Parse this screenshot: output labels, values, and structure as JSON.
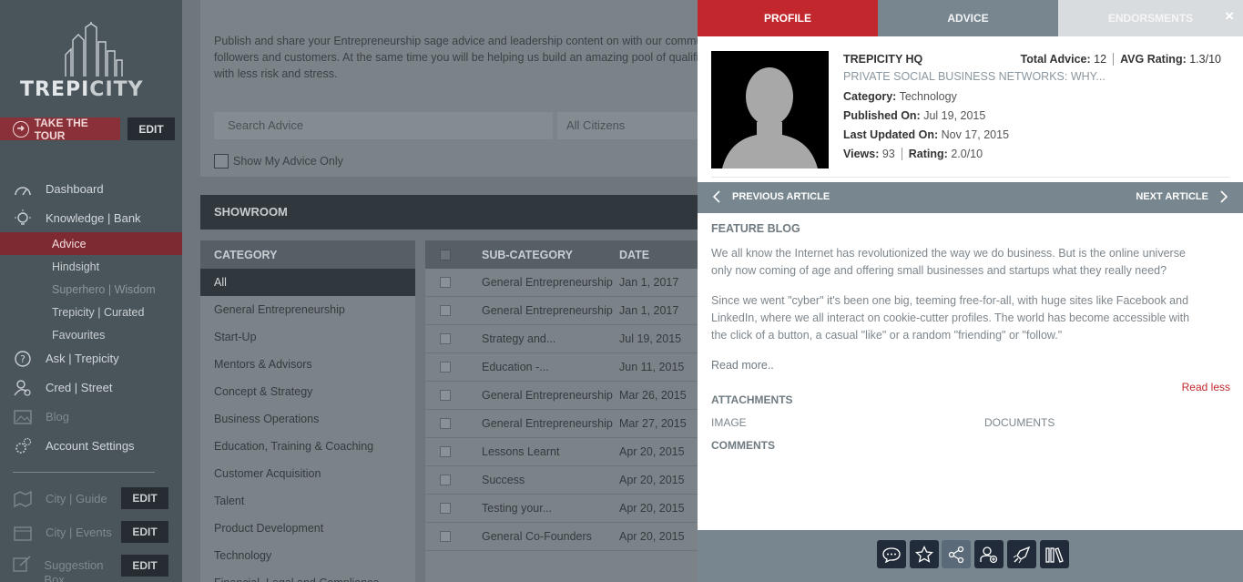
{
  "sidebar": {
    "logo_text_a": "TREPI",
    "logo_text_b": "CITY",
    "tour_label": "TAKE THE TOUR",
    "edit_label": "EDIT",
    "nav": {
      "dashboard": "Dashboard",
      "knowledge": "Knowledge | Bank",
      "advice": "Advice",
      "hindsight": "Hindsight",
      "superhero": "Superhero | Wisdom",
      "curated": "Trepicity | Curated",
      "favourites": "Favourites",
      "ask": "Ask | Trepicity",
      "cred": "Cred | Street",
      "blog": "Blog",
      "account": "Account Settings",
      "guide": "City | Guide",
      "events": "City | Events",
      "suggestion": "Suggestion Box"
    }
  },
  "main": {
    "intro_line1": "Publish and share your Entrepreneurship sage advice and leadership content on with our commu",
    "intro_line2": "followers and customers. At the same time you will be helping us build an amazing pool of qualifie",
    "intro_line3": "with less risk and stress.",
    "search_placeholder": "Search Advice",
    "citizens_select": "All Citizens",
    "my_advice_label": "Show My Advice Only",
    "showroom_title": "SHOWROOM",
    "category_header": "CATEGORY",
    "categories": [
      "All",
      "General Entrepreneurship",
      "Start-Up",
      "Mentors & Advisors",
      "Concept & Strategy",
      "Business Operations",
      "Education, Training & Coaching",
      "Customer Acquisition",
      "Talent",
      "Product Development",
      "Technology",
      "Financial, Legal and Compliance"
    ],
    "table_headers": {
      "sub": "SUB-CATEGORY",
      "date": "DATE"
    },
    "rows": [
      {
        "sub": "General Entrepreneurship",
        "date": "Jan 1, 2017"
      },
      {
        "sub": "General Entrepreneurship",
        "date": "Jan 1, 2017"
      },
      {
        "sub": "Strategy and...",
        "date": "Jul 19, 2015"
      },
      {
        "sub": "Education -...",
        "date": "Jun 11, 2015"
      },
      {
        "sub": "General Entrepreneurship",
        "date": "Mar 26, 2015"
      },
      {
        "sub": "General Entrepreneurship",
        "date": "Mar 27, 2015"
      },
      {
        "sub": "Lessons Learnt",
        "date": "Apr 20, 2015"
      },
      {
        "sub": "Success",
        "date": "Apr 20, 2015"
      },
      {
        "sub": "Testing your...",
        "date": "Apr 20, 2015"
      },
      {
        "sub": "General Co-Founders",
        "date": "Apr 20, 2015"
      }
    ]
  },
  "panel": {
    "tabs": {
      "profile": "PROFILE",
      "advice": "ADVICE",
      "endorsements": "ENDORSMENTS"
    },
    "close": "×",
    "org": "TREPICITY HQ",
    "total_advice_label": "Total Advice:",
    "total_advice_value": "12",
    "avg_rating_label": "AVG Rating:",
    "avg_rating_value": "1.3/10",
    "article_title": "PRIVATE SOCIAL BUSINESS NETWORKS: WHY...",
    "category_label": "Category:",
    "category_value": "Technology",
    "published_label": "Published On:",
    "published_value": "Jul 19, 2015",
    "updated_label": "Last Updated On:",
    "updated_value": "Nov 17, 2015",
    "views_label": "Views:",
    "views_value": "93",
    "rating_label": "Rating:",
    "rating_value": "2.0/10",
    "prev_label": "PREVIOUS ARTICLE",
    "next_label": "NEXT ARTICLE",
    "feature": "FEATURE BLOG",
    "para1_l1": "We all know the Internet has revolutionized the way we do business. But is the online universe",
    "para1_l2": "only now coming of age and offering small businesses and startups what they really need?",
    "para2_l1": "Since we went \"cyber\" it's been one big, teeming free-for-all, with huge sites like Facebook and",
    "para2_l2": "LinkedIn, where we all interact on cookie-cutter profiles. The world has become accessible with",
    "para2_l3": "the click of a button, a casual \"like\" or a random \"friending\" or \"follow.\"",
    "read_more": "Read more..",
    "read_less": "Read less",
    "attachments": "ATTACHMENTS",
    "image": "IMAGE",
    "documents": "DOCUMENTS",
    "comments": "COMMENTS"
  }
}
